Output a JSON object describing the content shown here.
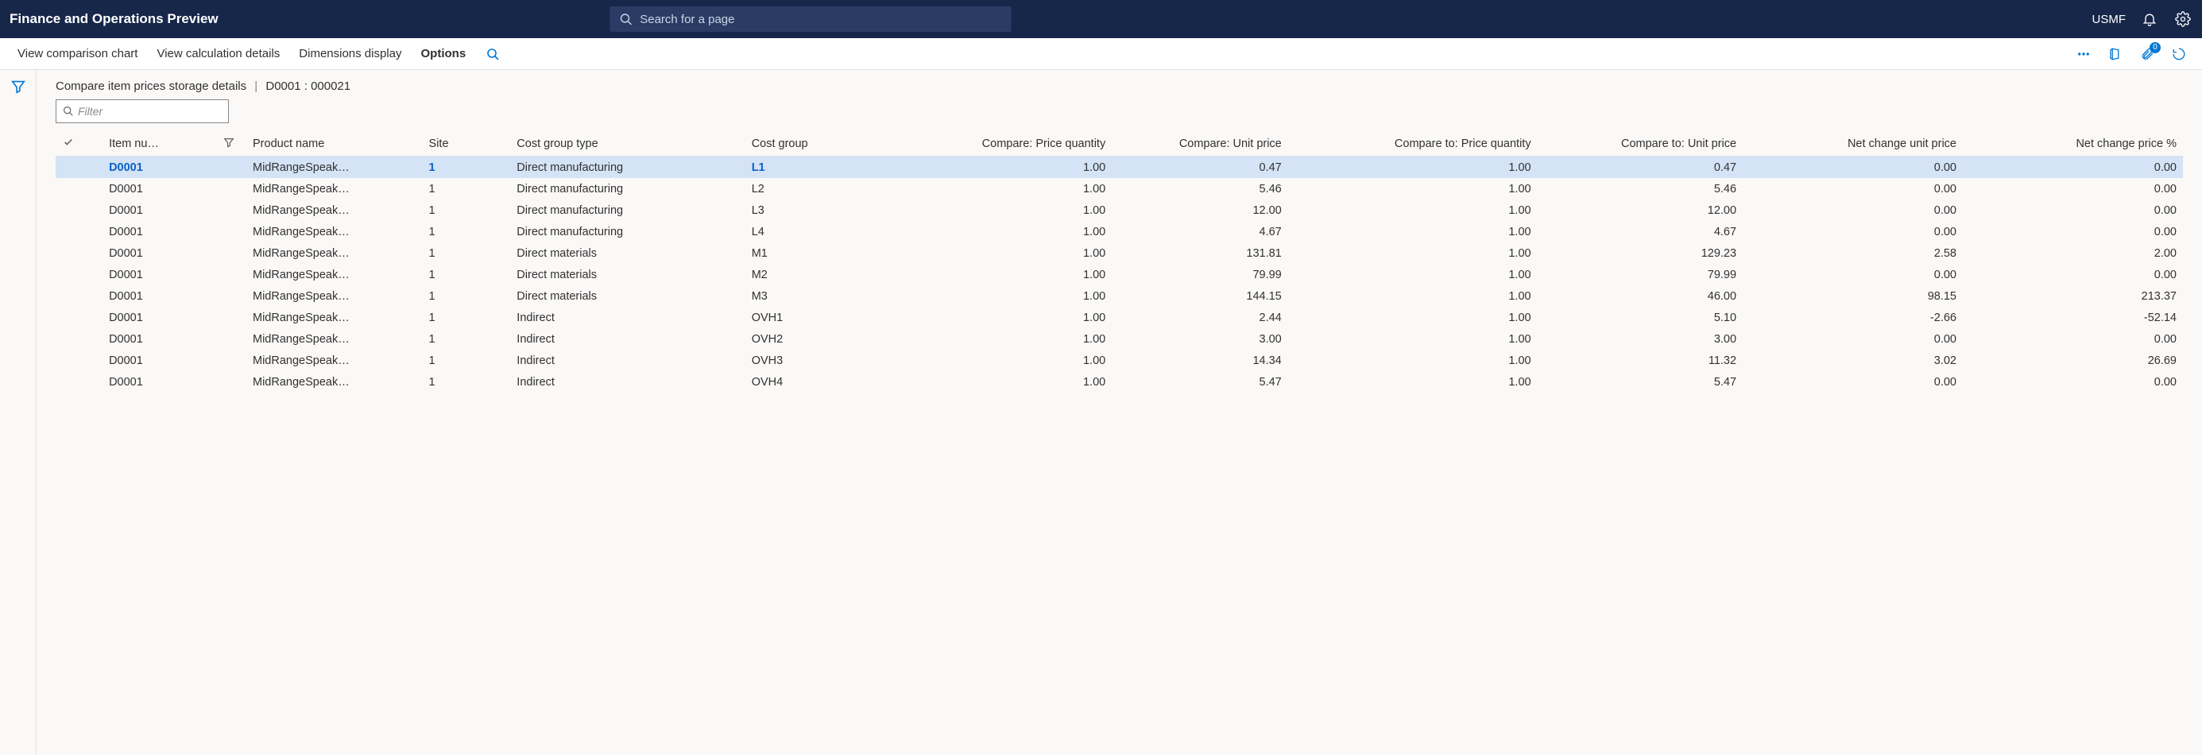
{
  "app": {
    "title": "Finance and Operations Preview",
    "search_placeholder": "Search for a page",
    "company": "USMF"
  },
  "actions": {
    "view_chart": "View comparison chart",
    "view_calc": "View calculation details",
    "dimensions": "Dimensions display",
    "options": "Options",
    "attach_count": "0"
  },
  "page": {
    "heading": "Compare item prices storage details",
    "context": "D0001 : 000021",
    "filter_placeholder": "Filter"
  },
  "columns": {
    "item_number": "Item nu…",
    "product_name": "Product name",
    "site": "Site",
    "cost_group_type": "Cost group type",
    "cost_group": "Cost group",
    "compare_price_qty": "Compare: Price quantity",
    "compare_unit_price": "Compare: Unit price",
    "compare_to_price_qty": "Compare to: Price quantity",
    "compare_to_unit_price": "Compare to: Unit price",
    "net_change_unit_price": "Net change unit price",
    "net_change_price_pct": "Net change price %"
  },
  "rows": [
    {
      "item": "D0001",
      "product": "MidRangeSpeak…",
      "site": "1",
      "cgt": "Direct manufacturing",
      "cg": "L1",
      "cpq": "1.00",
      "cup": "0.47",
      "ctpq": "1.00",
      "ctup": "0.47",
      "nc": "0.00",
      "ncp": "0.00",
      "selected": true
    },
    {
      "item": "D0001",
      "product": "MidRangeSpeak…",
      "site": "1",
      "cgt": "Direct manufacturing",
      "cg": "L2",
      "cpq": "1.00",
      "cup": "5.46",
      "ctpq": "1.00",
      "ctup": "5.46",
      "nc": "0.00",
      "ncp": "0.00"
    },
    {
      "item": "D0001",
      "product": "MidRangeSpeak…",
      "site": "1",
      "cgt": "Direct manufacturing",
      "cg": "L3",
      "cpq": "1.00",
      "cup": "12.00",
      "ctpq": "1.00",
      "ctup": "12.00",
      "nc": "0.00",
      "ncp": "0.00"
    },
    {
      "item": "D0001",
      "product": "MidRangeSpeak…",
      "site": "1",
      "cgt": "Direct manufacturing",
      "cg": "L4",
      "cpq": "1.00",
      "cup": "4.67",
      "ctpq": "1.00",
      "ctup": "4.67",
      "nc": "0.00",
      "ncp": "0.00"
    },
    {
      "item": "D0001",
      "product": "MidRangeSpeak…",
      "site": "1",
      "cgt": "Direct materials",
      "cg": "M1",
      "cpq": "1.00",
      "cup": "131.81",
      "ctpq": "1.00",
      "ctup": "129.23",
      "nc": "2.58",
      "ncp": "2.00"
    },
    {
      "item": "D0001",
      "product": "MidRangeSpeak…",
      "site": "1",
      "cgt": "Direct materials",
      "cg": "M2",
      "cpq": "1.00",
      "cup": "79.99",
      "ctpq": "1.00",
      "ctup": "79.99",
      "nc": "0.00",
      "ncp": "0.00"
    },
    {
      "item": "D0001",
      "product": "MidRangeSpeak…",
      "site": "1",
      "cgt": "Direct materials",
      "cg": "M3",
      "cpq": "1.00",
      "cup": "144.15",
      "ctpq": "1.00",
      "ctup": "46.00",
      "nc": "98.15",
      "ncp": "213.37"
    },
    {
      "item": "D0001",
      "product": "MidRangeSpeak…",
      "site": "1",
      "cgt": "Indirect",
      "cg": "OVH1",
      "cpq": "1.00",
      "cup": "2.44",
      "ctpq": "1.00",
      "ctup": "5.10",
      "nc": "-2.66",
      "ncp": "-52.14"
    },
    {
      "item": "D0001",
      "product": "MidRangeSpeak…",
      "site": "1",
      "cgt": "Indirect",
      "cg": "OVH2",
      "cpq": "1.00",
      "cup": "3.00",
      "ctpq": "1.00",
      "ctup": "3.00",
      "nc": "0.00",
      "ncp": "0.00"
    },
    {
      "item": "D0001",
      "product": "MidRangeSpeak…",
      "site": "1",
      "cgt": "Indirect",
      "cg": "OVH3",
      "cpq": "1.00",
      "cup": "14.34",
      "ctpq": "1.00",
      "ctup": "11.32",
      "nc": "3.02",
      "ncp": "26.69"
    },
    {
      "item": "D0001",
      "product": "MidRangeSpeak…",
      "site": "1",
      "cgt": "Indirect",
      "cg": "OVH4",
      "cpq": "1.00",
      "cup": "5.47",
      "ctpq": "1.00",
      "ctup": "5.47",
      "nc": "0.00",
      "ncp": "0.00"
    }
  ]
}
